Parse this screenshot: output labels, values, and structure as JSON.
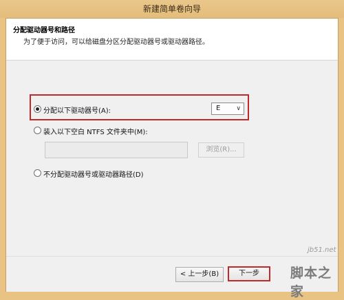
{
  "window": {
    "title": "新建简单卷向导"
  },
  "header": {
    "title": "分配驱动器号和路径",
    "subtitle": "为了便于访问，可以给磁盘分区分配驱动器号或驱动器路径。"
  },
  "options": {
    "assign_letter": {
      "label": "分配以下驱动器号(A):",
      "selected": true
    },
    "drive_letter": {
      "value": "E"
    },
    "mount_folder": {
      "label": "装入以下空白 NTFS 文件夹中(M):",
      "selected": false
    },
    "path_value": "",
    "browse_label": "浏览(R)...",
    "no_assign": {
      "label": "不分配驱动器号或驱动器路径(D)",
      "selected": false
    }
  },
  "footer": {
    "back_label": "< 上一步(B)",
    "next_label": "下一步"
  },
  "watermark": {
    "site": "jb51.net",
    "name": "脚本之家"
  },
  "colors": {
    "highlight": "#c0282a",
    "titlebar": "#e5bf7f"
  }
}
